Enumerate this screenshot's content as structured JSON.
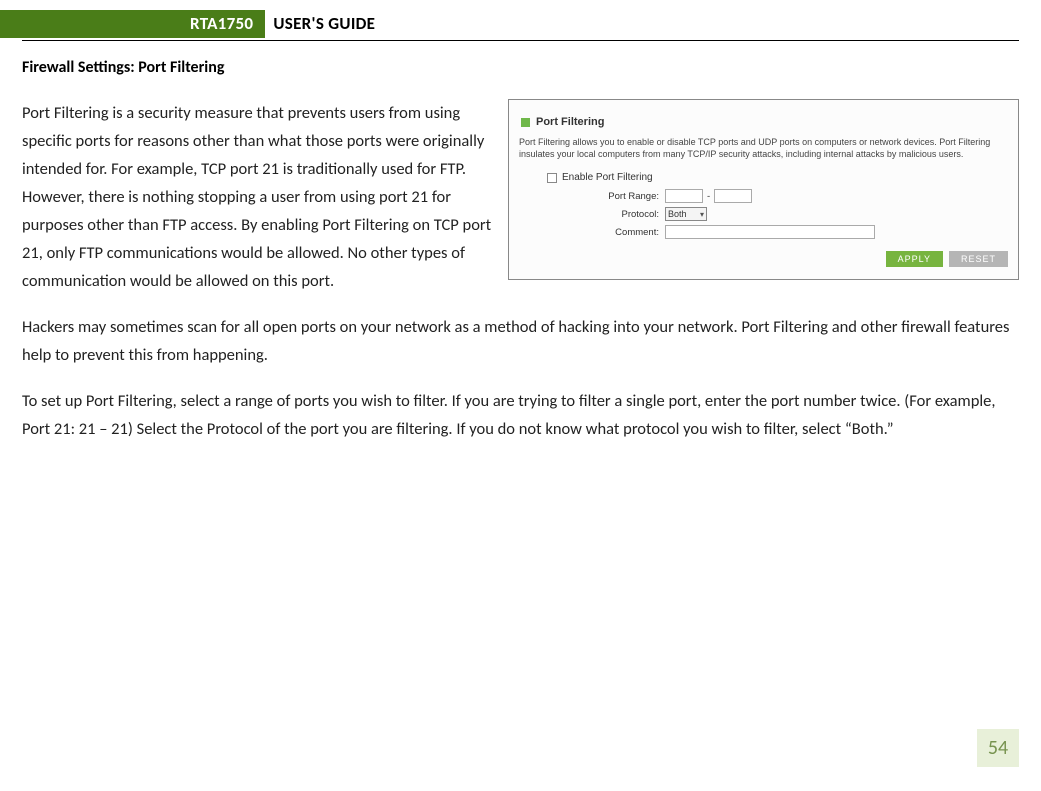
{
  "header": {
    "product": "RTA1750",
    "title": "USER'S GUIDE"
  },
  "section_heading": "Firewall Settings: Port Filtering",
  "paragraphs": {
    "p1": "Port Filtering is a security measure that prevents users from using specific ports for reasons other than what those ports were originally intended for.  For example, TCP port 21 is traditionally used for FTP.  However, there is nothing stopping a user from using port 21 for purposes other than FTP access.  By enabling Port Filtering on TCP port 21, only FTP communications would be allowed.  No other types of communication would be allowed on this port.",
    "p2": "Hackers may sometimes scan for all open ports on your network as a method of hacking into your network.  Port Filtering and other firewall features help to prevent this from happening.",
    "p3": "To set up Port Filtering, select a range of ports you wish to filter.  If you are trying to filter a single port, enter the port number twice.  (For example, Port 21:  21 – 21) Select the Protocol of the port you are filtering.  If you do not know what protocol you wish to filter, select “Both.”"
  },
  "screenshot": {
    "title": "Port Filtering",
    "description": "Port Filtering allows you to enable or disable TCP ports and UDP ports on computers or network devices. Port Filtering insulates your local computers from many TCP/IP security attacks, including internal attacks by malicious users.",
    "enable_label": "Enable Port Filtering",
    "labels": {
      "port_range": "Port Range:",
      "protocol": "Protocol:",
      "comment": "Comment:"
    },
    "protocol_value": "Both",
    "buttons": {
      "apply": "APPLY",
      "reset": "RESET"
    }
  },
  "page_number": "54"
}
